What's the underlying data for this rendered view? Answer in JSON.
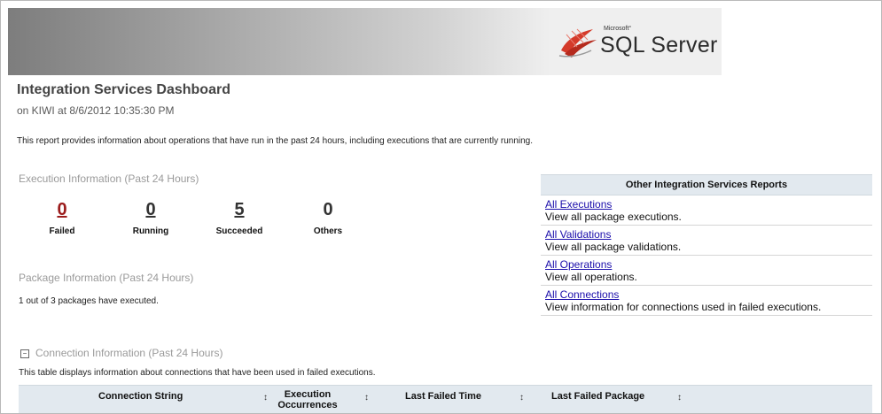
{
  "header": {
    "logo_microsoft": "Microsoft°",
    "logo_product": "SQL Server"
  },
  "report": {
    "title": "Integration Services Dashboard",
    "subtitle": "on KIWI at 8/6/2012 10:35:30 PM",
    "description": "This report provides information about operations that have run in the past 24 hours, including executions that are currently running."
  },
  "execution": {
    "heading": "Execution Information (Past 24 Hours)",
    "stats": [
      {
        "value": "0",
        "label": "Failed"
      },
      {
        "value": "0",
        "label": "Running"
      },
      {
        "value": "5",
        "label": "Succeeded"
      },
      {
        "value": "0",
        "label": "Others"
      }
    ]
  },
  "package": {
    "heading": "Package Information (Past 24 Hours)",
    "text": "1 out of 3 packages have executed."
  },
  "other_reports": {
    "heading": "Other Integration Services Reports",
    "items": [
      {
        "link": "All Executions",
        "description": "View all package executions."
      },
      {
        "link": "All Validations",
        "description": "View all package validations."
      },
      {
        "link": "All Operations",
        "description": "View all operations."
      },
      {
        "link": "All Connections",
        "description": "View information for connections used in failed executions."
      }
    ]
  },
  "connection": {
    "toggle_symbol": "−",
    "heading": "Connection Information (Past 24 Hours)",
    "description": "This table displays information about connections that have been used in failed executions.",
    "columns": [
      "Connection String",
      "Execution Occurrences",
      "Last Failed Time",
      "Last Failed Package"
    ],
    "sort_symbol": "↕"
  },
  "colors": {
    "failed": "#9b1c1c",
    "link": "#1a0dab",
    "table_header_bg": "#e2e9ef"
  },
  "icons": [
    "sql-server-logo-icon",
    "collapse-toggle-icon",
    "sort-icon"
  ]
}
